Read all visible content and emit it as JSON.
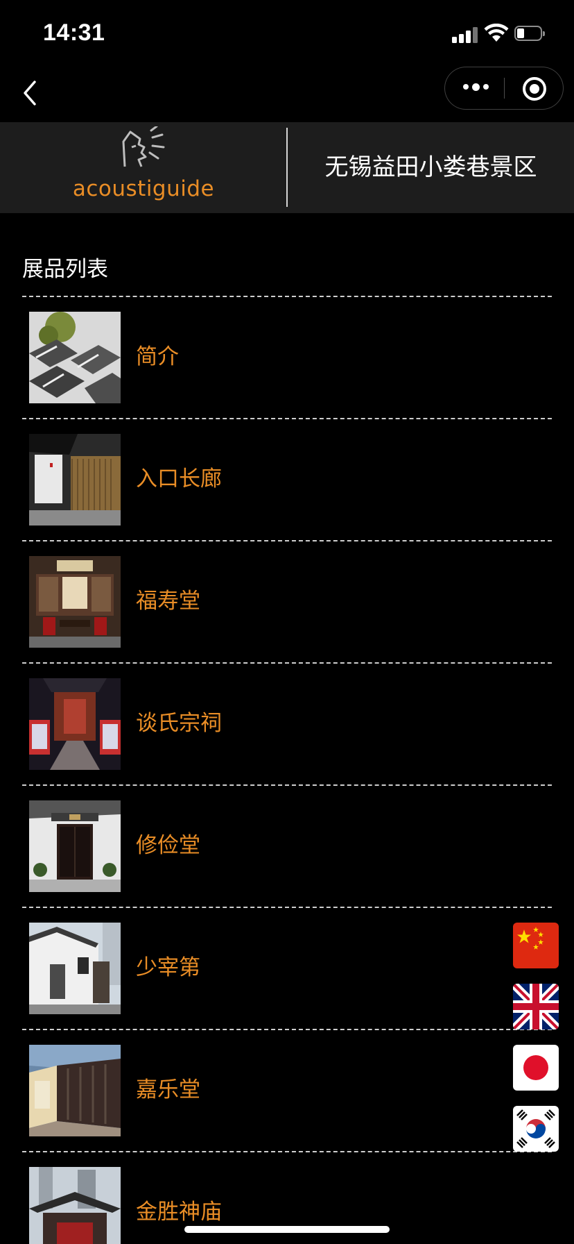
{
  "status_bar": {
    "time": "14:31"
  },
  "header": {
    "logo_text": "acoustiguide",
    "site_name": "无锡益田小娄巷景区"
  },
  "list": {
    "heading": "展品列表",
    "items": [
      {
        "title": "简介",
        "thumb": "tiled-rooftops-photo"
      },
      {
        "title": "入口长廊",
        "thumb": "entrance-corridor-photo"
      },
      {
        "title": "福寿堂",
        "thumb": "hall-interior-photo"
      },
      {
        "title": "谈氏宗祠",
        "thumb": "ancestral-hall-photo"
      },
      {
        "title": "修俭堂",
        "thumb": "black-gate-photo"
      },
      {
        "title": "少宰第",
        "thumb": "white-wall-building-photo"
      },
      {
        "title": "嘉乐堂",
        "thumb": "courtyard-photo"
      },
      {
        "title": "金胜神庙",
        "thumb": "temple-roof-photo"
      }
    ]
  },
  "languages": [
    {
      "name": "chinese-flag",
      "lang": "zh"
    },
    {
      "name": "uk-flag",
      "lang": "en"
    },
    {
      "name": "japan-flag",
      "lang": "ja"
    },
    {
      "name": "korea-flag",
      "lang": "ko"
    }
  ],
  "colors": {
    "accent": "#e98d26",
    "background": "#000000",
    "banner": "#1d1d1d"
  }
}
